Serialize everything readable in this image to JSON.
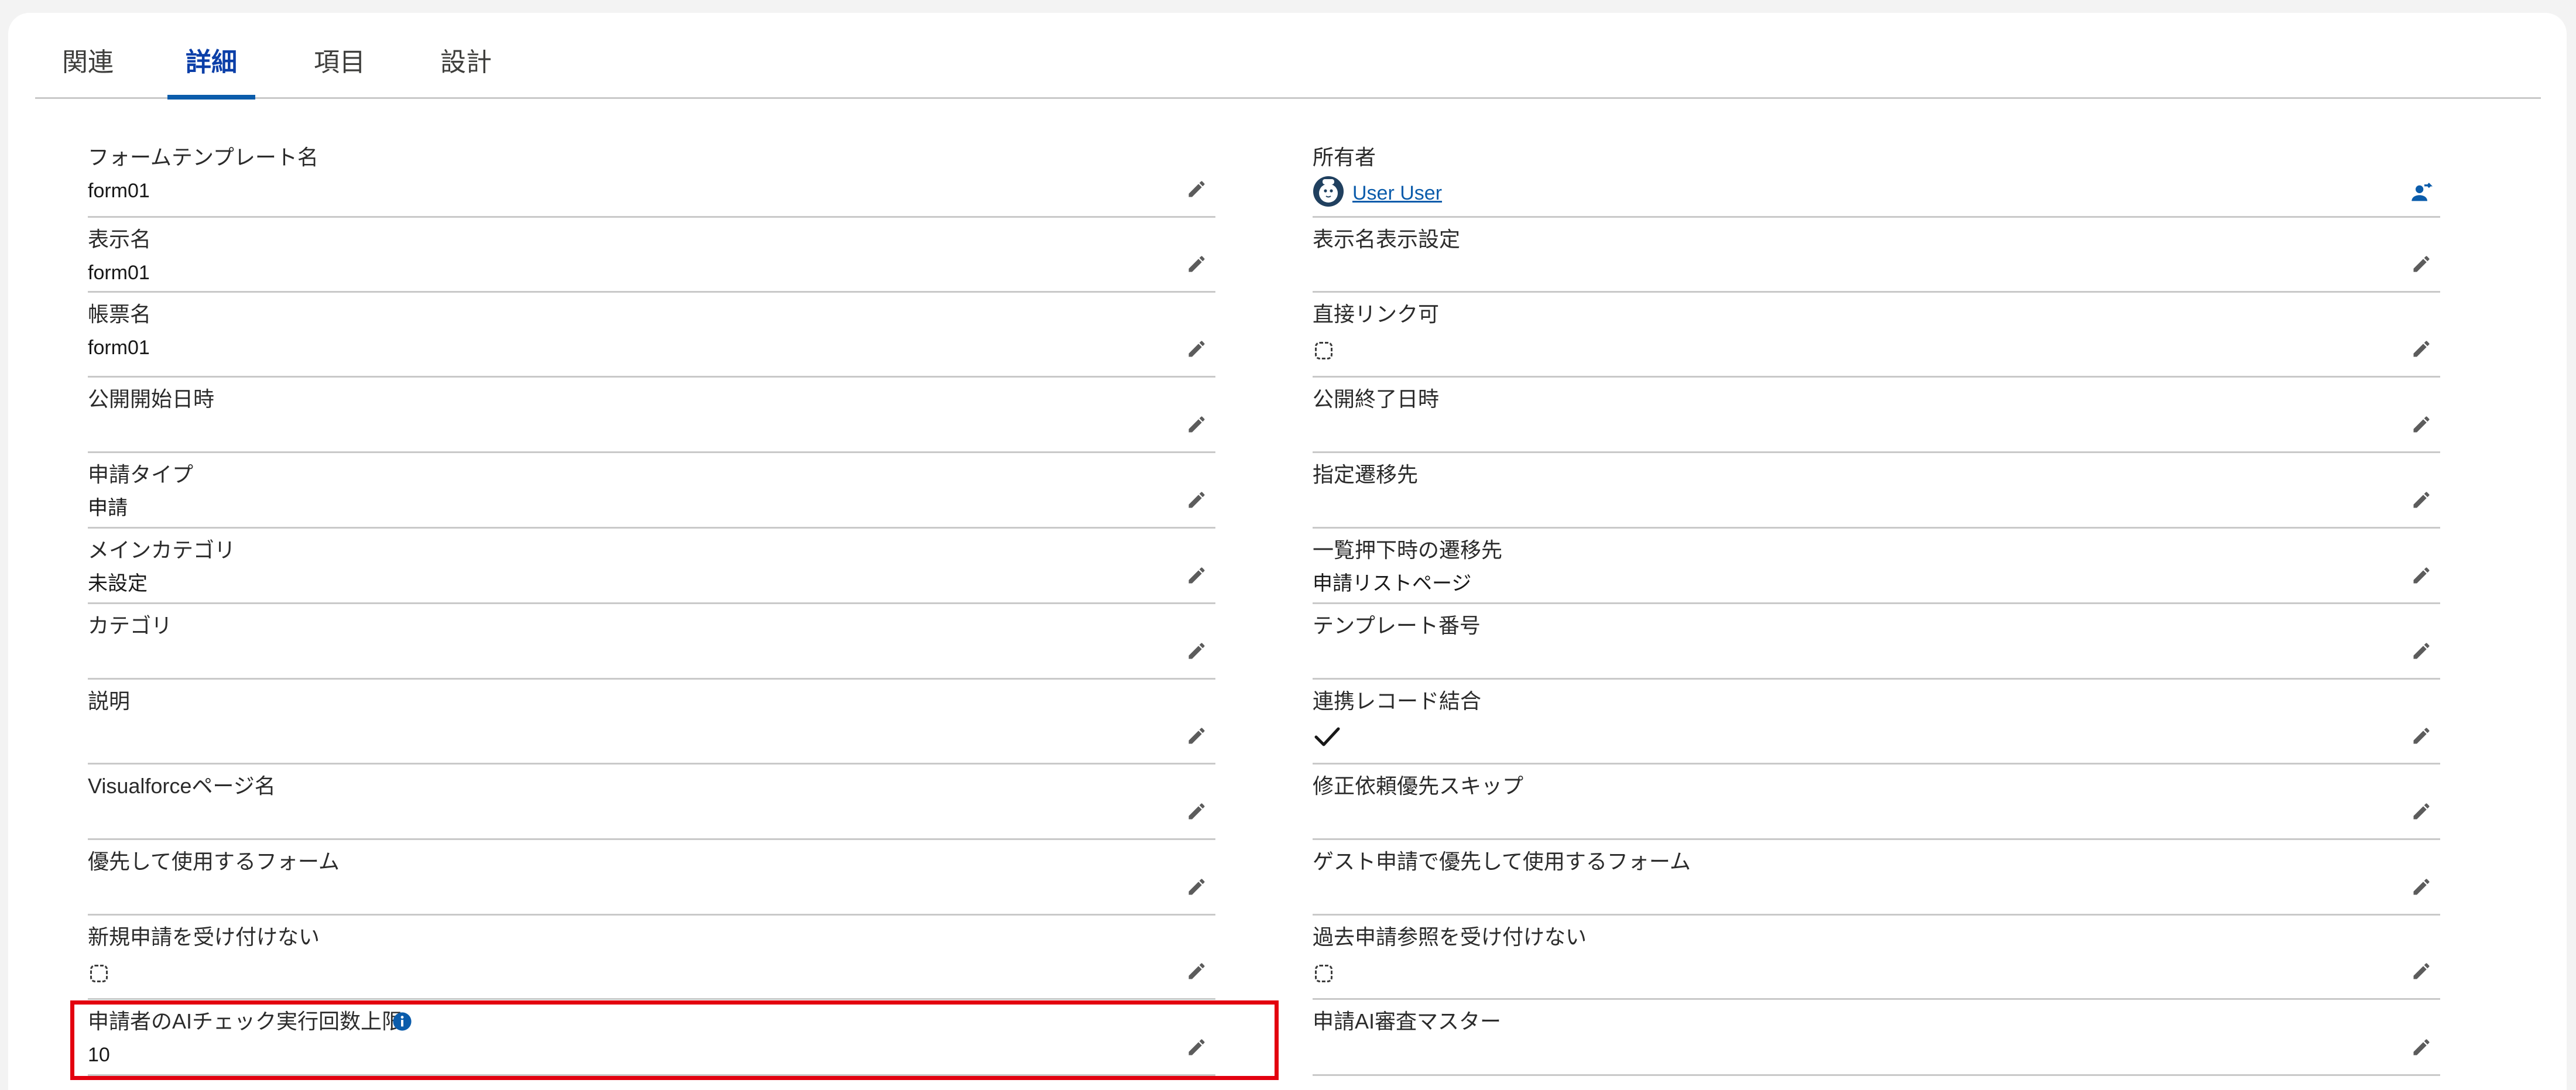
{
  "tabs": [
    {
      "label": "関連",
      "active": false
    },
    {
      "label": "詳細",
      "active": true
    },
    {
      "label": "項目",
      "active": false
    },
    {
      "label": "設計",
      "active": false
    }
  ],
  "left_fields": [
    {
      "label": "フォームテンプレート名",
      "value": "form01"
    },
    {
      "label": "表示名",
      "value": "form01"
    },
    {
      "label": "帳票名",
      "value": "form01"
    },
    {
      "label": "公開開始日時",
      "value": ""
    },
    {
      "label": "申請タイプ",
      "value": "申請"
    },
    {
      "label": "メインカテゴリ",
      "value": "未設定"
    },
    {
      "label": "カテゴリ",
      "value": ""
    },
    {
      "label": "説明",
      "value": ""
    },
    {
      "label": "Visualforceページ名",
      "value": ""
    },
    {
      "label": "優先して使用するフォーム",
      "value": ""
    },
    {
      "label": "新規申請を受け付けない",
      "value": "",
      "checkbox": "unchecked"
    },
    {
      "label": "申請者のAIチェック実行回数上限",
      "value": "10",
      "info": true,
      "highlighted": true
    }
  ],
  "right_fields": [
    {
      "label": "所有者",
      "value": "User User",
      "owner": true
    },
    {
      "label": "表示名表示設定",
      "value": ""
    },
    {
      "label": "直接リンク可",
      "value": "",
      "checkbox": "unchecked"
    },
    {
      "label": "公開終了日時",
      "value": ""
    },
    {
      "label": "指定遷移先",
      "value": ""
    },
    {
      "label": "一覧押下時の遷移先",
      "value": "申請リストページ"
    },
    {
      "label": "テンプレート番号",
      "value": ""
    },
    {
      "label": "連携レコード結合",
      "value": "",
      "checkbox": "checked"
    },
    {
      "label": "修正依頼優先スキップ",
      "value": ""
    },
    {
      "label": "ゲスト申請で優先して使用するフォーム",
      "value": ""
    },
    {
      "label": "過去申請参照を受け付けない",
      "value": "",
      "checkbox": "unchecked"
    },
    {
      "label": "申請AI審査マスター",
      "value": ""
    }
  ],
  "colors": {
    "accent": "#0b5cab",
    "highlight": "#e3000f",
    "divider": "#c9c9c9"
  }
}
